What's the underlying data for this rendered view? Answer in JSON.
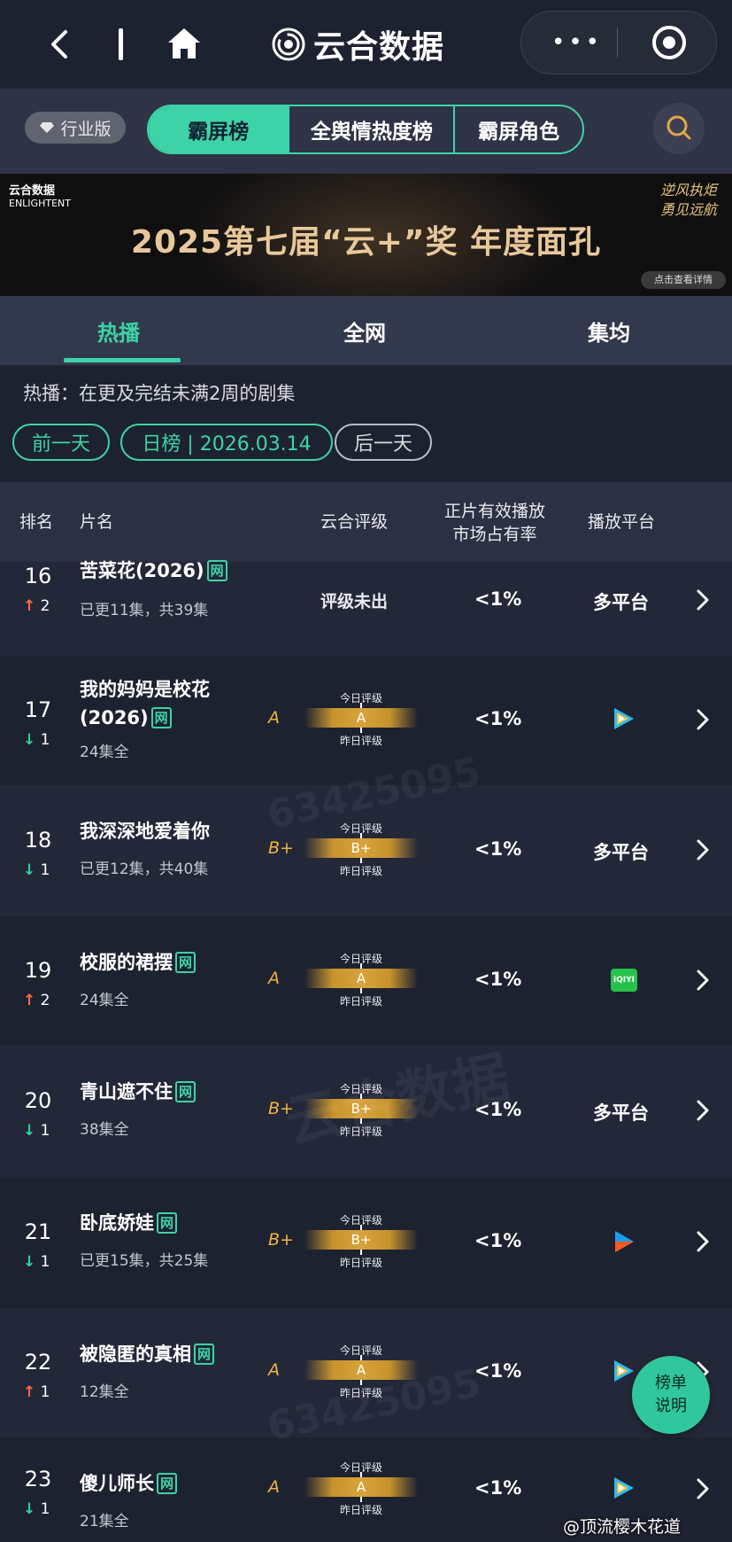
{
  "header": {
    "brand": "云合数据",
    "icons": [
      "back-icon",
      "home-icon",
      "more-icon",
      "target-icon"
    ]
  },
  "filters": {
    "industry": "行业版",
    "segments": [
      "霸屏榜",
      "全舆情热度榜",
      "霸屏角色"
    ],
    "active_segment": "霸屏榜"
  },
  "banner": {
    "logo_zh": "云合数据",
    "logo_en": "ENLIGHTENT",
    "title": "2025第七届“云+”奖 年度面孔",
    "calligraphy": "逆风执炬 勇见远航",
    "button": "点击查看详情"
  },
  "tabs": [
    "热播",
    "全网",
    "集均"
  ],
  "active_tab": "热播",
  "description": "热播：在更及完结未满2周的剧集",
  "date_nav": {
    "prev": "前一天",
    "current": "日榜 | 2026.03.14",
    "next": "后一天"
  },
  "table": {
    "headers": {
      "rank": "排名",
      "name": "片名",
      "grade": "云合评级",
      "share_line1": "正片有效播放",
      "share_line2": "市场占有率",
      "platform": "播放平台"
    },
    "today_label": "今日评级",
    "yesterday_label": "昨日评级",
    "rows": [
      {
        "rank": "16",
        "dir": "up",
        "change": "2",
        "title": "苦菜花(2026)",
        "tag": "网",
        "episodes": "已更11集，共39集",
        "grade": "",
        "grade_text": "评级未出",
        "share": "<1%",
        "platform": "多平台"
      },
      {
        "rank": "17",
        "dir": "down",
        "change": "1",
        "title": "我的妈妈是校花(2026)",
        "tag": "网",
        "episodes": "24集全",
        "grade": "A",
        "share": "<1%",
        "platform": "tencent-video-icon"
      },
      {
        "rank": "18",
        "dir": "down",
        "change": "1",
        "title": "我深深地爱着你",
        "tag": "",
        "episodes": "已更12集，共40集",
        "grade": "B+",
        "share": "<1%",
        "platform": "多平台"
      },
      {
        "rank": "19",
        "dir": "up",
        "change": "2",
        "title": "校服的裙摆",
        "tag": "网",
        "episodes": "24集全",
        "grade": "A",
        "share": "<1%",
        "platform": "iqiyi-icon"
      },
      {
        "rank": "20",
        "dir": "down",
        "change": "1",
        "title": "青山遮不住",
        "tag": "网",
        "episodes": "38集全",
        "grade": "B+",
        "share": "<1%",
        "platform": "多平台"
      },
      {
        "rank": "21",
        "dir": "down",
        "change": "1",
        "title": "卧底娇娃",
        "tag": "网",
        "episodes": "已更15集，共25集",
        "grade": "B+",
        "share": "<1%",
        "platform": "youku-icon"
      },
      {
        "rank": "22",
        "dir": "up",
        "change": "1",
        "title": "被隐匿的真相",
        "tag": "网",
        "episodes": "12集全",
        "grade": "A",
        "share": "<1%",
        "platform": "tencent-video-icon"
      },
      {
        "rank": "23",
        "dir": "down",
        "change": "1",
        "title": "傻儿师长",
        "tag": "网",
        "episodes": "21集全",
        "grade": "A",
        "share": "<1%",
        "platform": "tencent-video-icon"
      }
    ]
  },
  "float_button": {
    "line1": "榜单",
    "line2": "说明"
  },
  "credit": "@顶流樱木花道",
  "iqiyi_text": "iQIYI",
  "watermark": {
    "number": "63425095",
    "brand": "云合数据",
    "en": "ENLIGHTENT"
  },
  "colors": {
    "accent": "#3ed3a6",
    "up": "#ff6b4a",
    "down": "#2fd3a0",
    "grade": "#f1b43c",
    "background": "#1d2230"
  }
}
